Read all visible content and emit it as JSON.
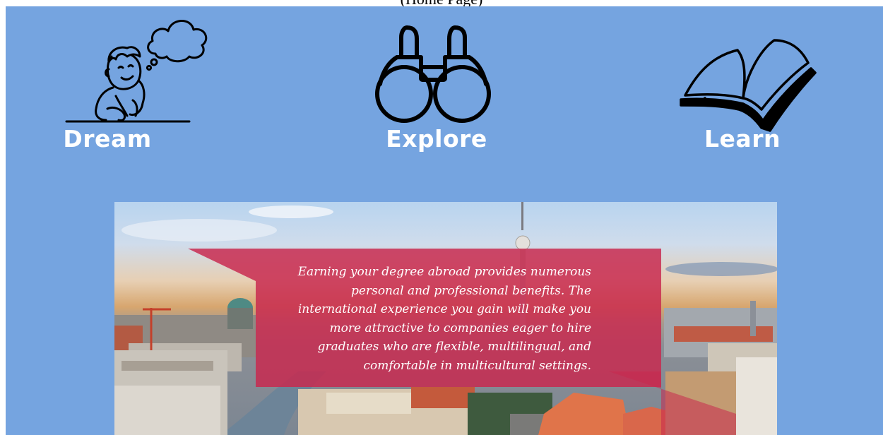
{
  "page": {
    "caption": "(Home Page)"
  },
  "nav": {
    "items": [
      {
        "label": "Dream",
        "icon": "dreaming-boy-icon"
      },
      {
        "label": "Explore",
        "icon": "binoculars-icon"
      },
      {
        "label": "Learn",
        "icon": "open-book-icon"
      }
    ]
  },
  "hero": {
    "quote": "Earning your degree abroad provides numerous personal and professional benefits. The international experience you gain will make you more attractive to companies eager to hire graduates who are flexible, multilingual, and comfortable in multicultural settings.",
    "banner_color": "#c8284f"
  },
  "colors": {
    "panel": "#75a4e0",
    "label": "#ffffff"
  }
}
